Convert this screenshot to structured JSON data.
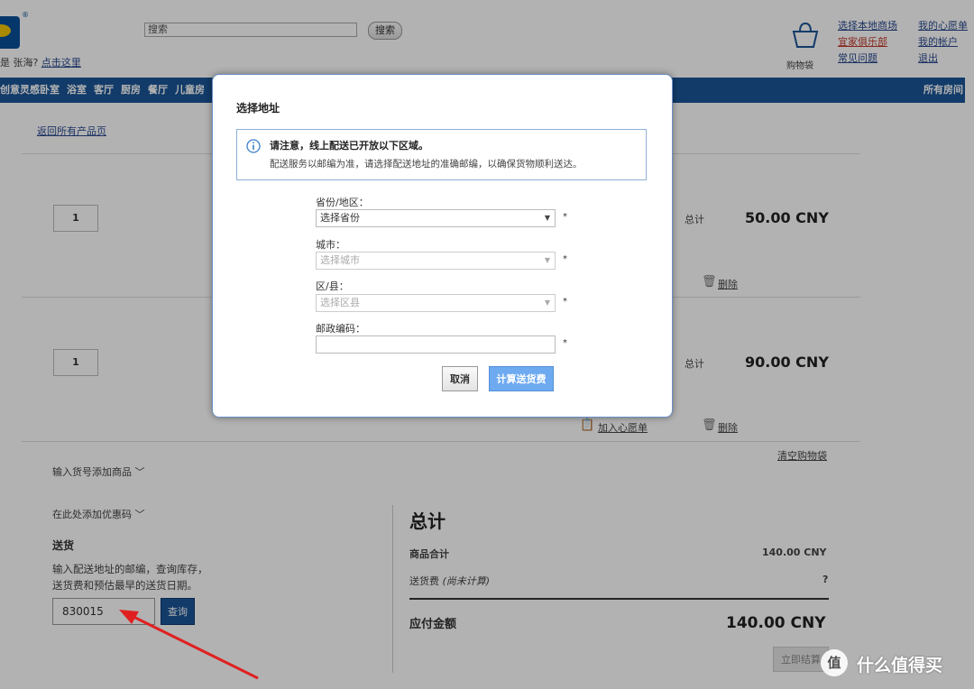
{
  "header": {
    "search_value": "搜索",
    "search_button": "搜索",
    "greeting_prefix": "是 张海?",
    "greeting_link": "点击这里",
    "bag_label": "购物袋",
    "links_col1": [
      "选择本地商场",
      "宜家俱乐部",
      "常见问题"
    ],
    "links_col2": [
      "我的心愿单",
      "我的帐户",
      "退出"
    ]
  },
  "nav": {
    "items": [
      "创意灵感",
      "卧室",
      "浴室",
      "客厅",
      "厨房",
      "餐厅",
      "儿童房"
    ],
    "all_rooms": "所有房间"
  },
  "cart": {
    "back_link": "返回所有产品页",
    "items": [
      {
        "qty": "1",
        "total_label": "总计",
        "total": "50.00 CNY",
        "delete": "删除"
      },
      {
        "qty": "1",
        "total_label": "总计",
        "total": "90.00 CNY",
        "delete": "删除",
        "wishlist": "加入心愿单"
      }
    ],
    "clear_cart": "清空购物袋",
    "add_by_number": "输入货号添加商品",
    "add_coupon": "在此处添加优惠码",
    "delivery_title": "送货",
    "delivery_desc_1": "输入配送地址的邮编，查询库存，",
    "delivery_desc_2": "送货费和预估最早的送货日期。",
    "postcode": "830015",
    "query_button": "查询"
  },
  "summary": {
    "title": "总计",
    "subtotal_label": "商品合计",
    "subtotal": "140.00 CNY",
    "shipping_label": "送货费",
    "shipping_note": "(尚未计算)",
    "shipping_value": "?",
    "payable_label": "应付金额",
    "payable": "140.00 CNY",
    "checkout": "立即结算"
  },
  "modal": {
    "title": "选择地址",
    "notice_title": "请注意，线上配送已开放以下区域。",
    "notice_body": "配送服务以邮编为准，请选择配送地址的准确邮编，以确保货物顺利送达。",
    "province_label": "省份/地区：",
    "province_value": "选择省份",
    "city_label": "城市：",
    "city_value": "选择城市",
    "district_label": "区/县：",
    "district_value": "选择区县",
    "postcode_label": "邮政编码：",
    "postcode_value": "",
    "required_mark": "*",
    "cancel": "取消",
    "calculate": "计算送货费"
  },
  "watermark": {
    "badge": "值",
    "text": "什么值得买"
  },
  "colors": {
    "nav": "#1b5597",
    "accent_button": "#6eaaf0",
    "arrow": "#e02020"
  }
}
